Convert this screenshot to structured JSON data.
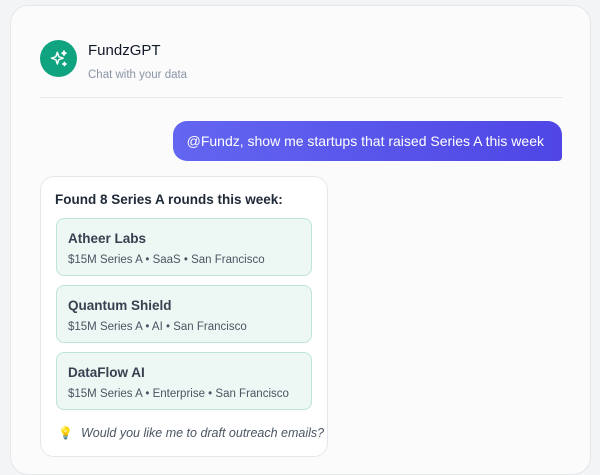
{
  "header": {
    "title": "FundzGPT",
    "subtitle": "Chat with your data",
    "logo_icon": "sparkles-icon",
    "logo_color": "#10a37f"
  },
  "user_message": {
    "text": "@Fundz, show me startups that raised Series A this week",
    "colors": [
      "#6366f1",
      "#4f46e5"
    ]
  },
  "assistant_message": {
    "heading": "Found 8 Series A rounds this week:",
    "results": [
      {
        "name": "Atheer Labs",
        "meta": "$15M Series A • SaaS • San Francisco"
      },
      {
        "name": "Quantum Shield",
        "meta": "$15M Series A • AI • San Francisco"
      },
      {
        "name": "DataFlow AI",
        "meta": "$15M Series A • Enterprise • San Francisco"
      }
    ],
    "followup_icon": "lightbulb-icon",
    "followup": "Would you like me to draft outreach emails?"
  }
}
